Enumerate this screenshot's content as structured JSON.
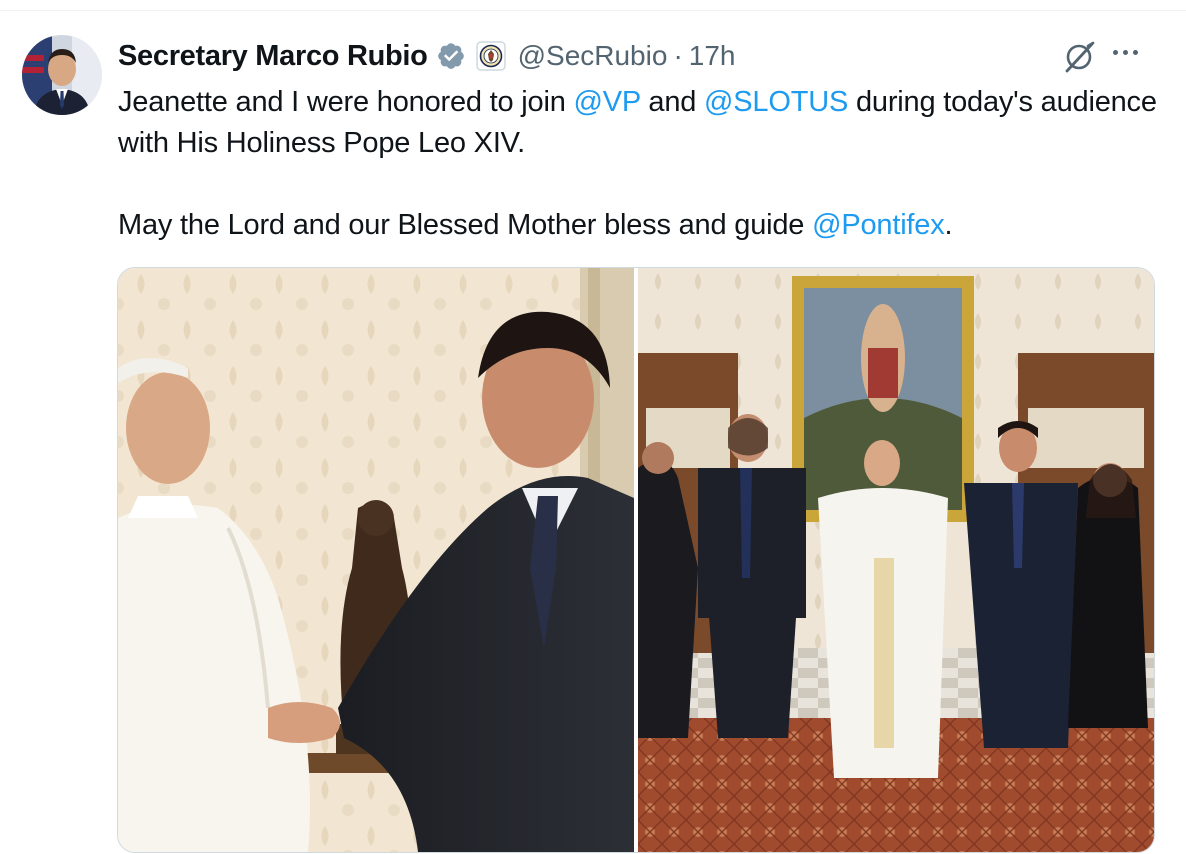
{
  "author": {
    "display_name": "Secretary Marco Rubio",
    "handle": "@SecRubio",
    "separator": "·",
    "time": "17h",
    "verified_icon": "verified-badge-icon",
    "affiliation_icon": "state-department-seal-icon"
  },
  "tweet": {
    "line1_before": "Jeanette and I were honored to join ",
    "mention_vp": "@VP",
    "line1_mid": " and ",
    "mention_slotus": "@SLOTUS",
    "line1_after": " during today's audience with His Holiness Pope Leo XIV.",
    "line2_before": "May the Lord and our Blessed Mother bless and guide ",
    "mention_pontifex": "@Pontifex",
    "line2_after": "."
  },
  "actions": {
    "grok_icon": "grok-icon",
    "more_icon": "more-options-icon"
  },
  "media": {
    "photos": [
      {
        "name": "photo-handshake"
      },
      {
        "name": "photo-group"
      }
    ]
  },
  "colors": {
    "link": "#1d9bf0",
    "secondary_text": "#536471",
    "verified": "#829aab",
    "border": "#cfd9de"
  }
}
